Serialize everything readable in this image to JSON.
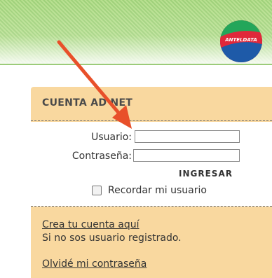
{
  "header": {
    "logo_text": "ANTELDATA",
    "colors": {
      "accent": "#a7d87e",
      "brand_red": "#e0283a",
      "brand_blue": "#1e5aa8",
      "brand_green": "#23a65a"
    }
  },
  "panel": {
    "title": "CUENTA ADSLNET",
    "title_visible": "CUENTA AD NET",
    "background": "#f9d89f",
    "username_label": "Usuario:",
    "username_value": "",
    "password_label": "Contraseña:",
    "password_value": "",
    "submit_label": "INGRESAR",
    "remember_label": "Recordar mi usuario",
    "remember_checked": false,
    "create_account_link": "Crea tu cuenta aquí",
    "create_account_note": "Si no sos usuario registrado.",
    "forgot_password_link": "Olvidé mi contraseña"
  },
  "annotation": {
    "icon": "red-arrow-icon",
    "color": "#e8502a"
  }
}
